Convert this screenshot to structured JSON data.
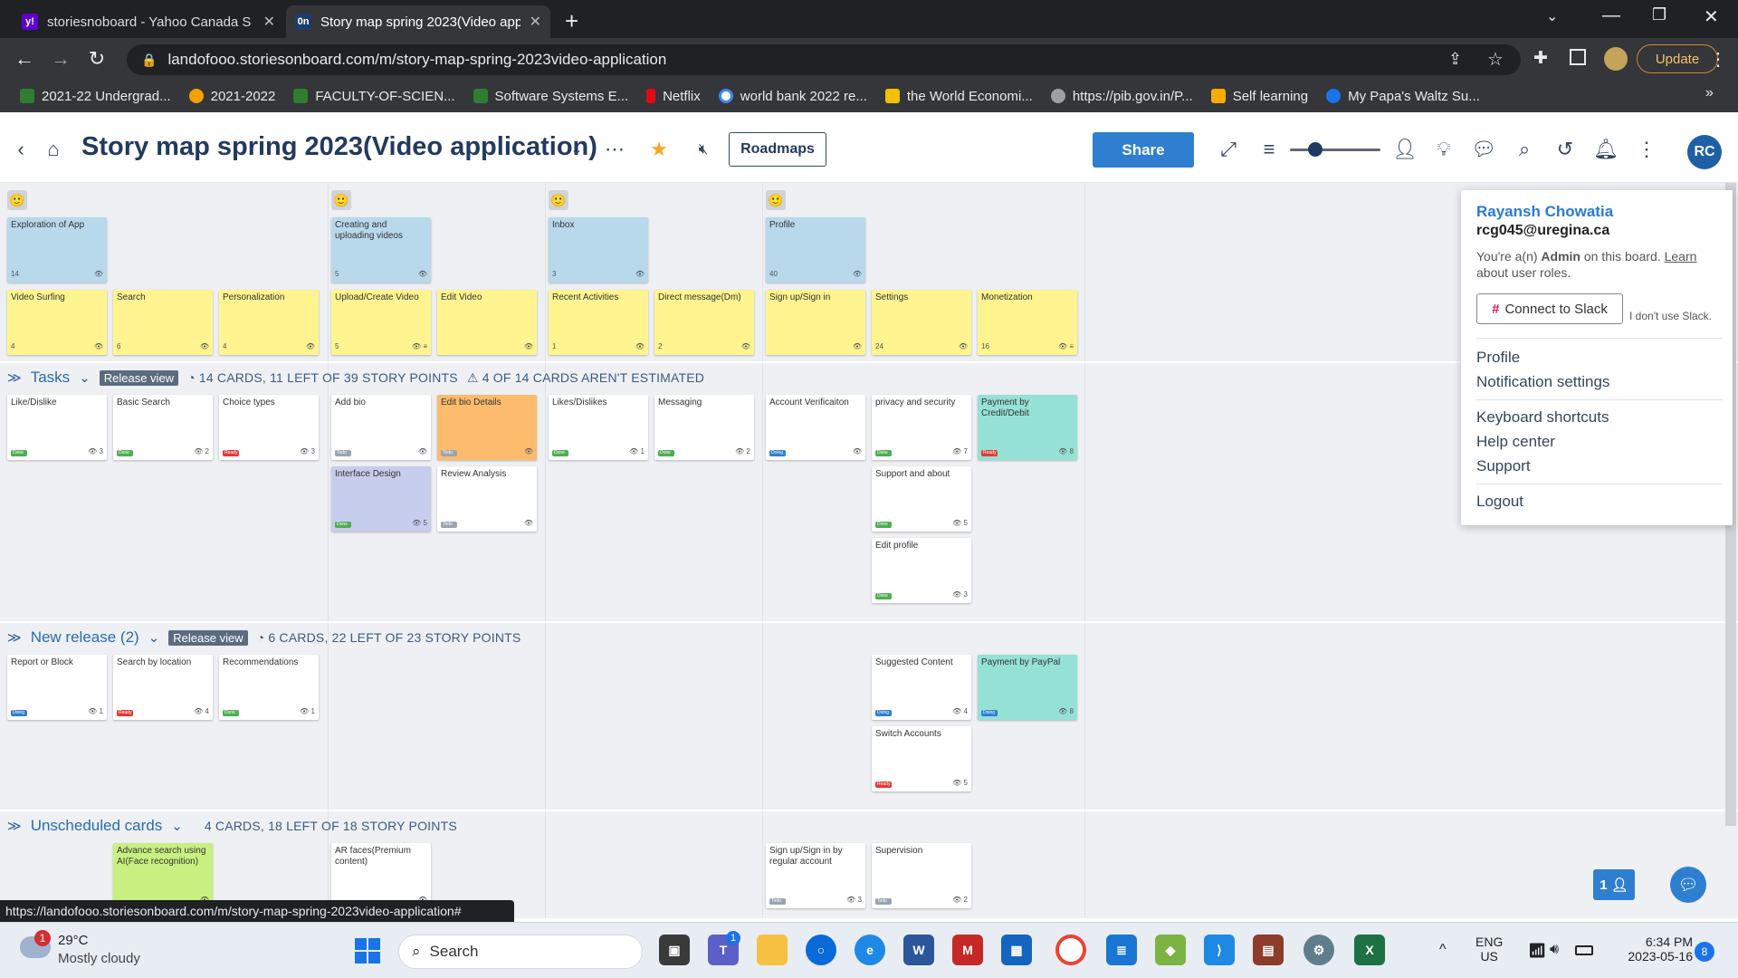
{
  "browser": {
    "tabs": [
      {
        "title": "storiesnoboard - Yahoo Canada S",
        "fav_letter": "y!",
        "fav_color": "#6001d2"
      },
      {
        "title": "Story map spring 2023(Video app",
        "fav_letter": "0n",
        "fav_color": "#1f3b6e"
      }
    ],
    "url": "landofooo.storiesonboard.com/m/story-map-spring-2023video-application",
    "update_label": "Update",
    "bookmarks": [
      {
        "label": "2021-22 Undergrad...",
        "color": "#2e7d32"
      },
      {
        "label": "2021-2022",
        "color": "#f4a000"
      },
      {
        "label": "FACULTY-OF-SCIEN...",
        "color": "#2e7d32"
      },
      {
        "label": "Software Systems E...",
        "color": "#2e7d32"
      },
      {
        "label": "Netflix",
        "color": "#e50914"
      },
      {
        "label": "world bank 2022 re...",
        "color": "#4285f4"
      },
      {
        "label": "the World Economi...",
        "color": "#f2c200"
      },
      {
        "label": "https://pib.gov.in/P...",
        "color": "#9aa0a6"
      },
      {
        "label": "Self learning",
        "color": "#f9ab00"
      },
      {
        "label": "My Papa's Waltz Su...",
        "color": "#1a73e8"
      }
    ]
  },
  "header": {
    "board_title": "Story map spring 2023(Video application)",
    "roadmaps_label": "Roadmaps",
    "share_label": "Share",
    "avatar_initials": "RC"
  },
  "goals": [
    {
      "label": "Exploration of App",
      "count": "14"
    },
    {
      "label": "Creating and uploading videos",
      "count": "5"
    },
    {
      "label": "Inbox",
      "count": "3"
    },
    {
      "label": "Profile",
      "count": "40"
    }
  ],
  "steps": [
    {
      "label": "Video Surfing",
      "count": "4"
    },
    {
      "label": "Search",
      "count": "6"
    },
    {
      "label": "Personalization",
      "count": "4"
    },
    {
      "label": "Upload/Create Video",
      "count": "5"
    },
    {
      "label": "Edit Video",
      "count": ""
    },
    {
      "label": "Recent Activities",
      "count": "1"
    },
    {
      "label": "Direct message(Dm)",
      "count": "2"
    },
    {
      "label": "Sign up/Sign in",
      "count": ""
    },
    {
      "label": "Settings",
      "count": "24"
    },
    {
      "label": "Monetization",
      "count": "16"
    }
  ],
  "releases": [
    {
      "name": "Tasks",
      "view": "Release view",
      "stats": "14 CARDS, 11 LEFT OF 39 STORY POINTS",
      "warn": "4 OF 14 CARDS AREN'T ESTIMATED"
    },
    {
      "name": "New release (2)",
      "view": "Release view",
      "stats": "6 CARDS, 22 LEFT OF 23 STORY POINTS",
      "warn": ""
    },
    {
      "name": "Unscheduled cards",
      "view": "",
      "stats": "4 CARDS, 18 LEFT OF 18 STORY POINTS",
      "warn": ""
    }
  ],
  "task_cards": [
    {
      "label": "Like/Dislike",
      "status": "Done",
      "points": "3"
    },
    {
      "label": "Basic Search",
      "status": "Done",
      "points": "2"
    },
    {
      "label": "Choice types",
      "status": "Ready",
      "points": "3"
    },
    {
      "label": "Add bio",
      "status": "Todo",
      "points": ""
    },
    {
      "label": "Edit bio Details",
      "status": "Todo",
      "points": ""
    },
    {
      "label": "Likes/Dislikes",
      "status": "Done",
      "points": "1"
    },
    {
      "label": "Messaging",
      "status": "Done",
      "points": "2"
    },
    {
      "label": "Account Verificaiton",
      "status": "Doing",
      "points": ""
    },
    {
      "label": "privacy and security",
      "status": "Done",
      "points": "7"
    },
    {
      "label": "Payment by Credit/Debit",
      "status": "Ready",
      "points": "8"
    },
    {
      "label": "Interface Design",
      "status": "Done",
      "points": "5"
    },
    {
      "label": "Review Analysis",
      "status": "Todo",
      "points": ""
    },
    {
      "label": "Support and about",
      "status": "Done",
      "points": "5"
    },
    {
      "label": "Edit profile",
      "status": "Done",
      "points": "3"
    }
  ],
  "release2_cards": [
    {
      "label": "Report or Block",
      "status": "Doing",
      "points": "1"
    },
    {
      "label": "Search by location",
      "status": "Ready",
      "points": "4"
    },
    {
      "label": "Recommendations",
      "status": "Done",
      "points": "1"
    },
    {
      "label": "Suggested Content",
      "status": "Doing",
      "points": "4"
    },
    {
      "label": "Payment by PayPal",
      "status": "Doing",
      "points": "8"
    },
    {
      "label": "Switch Accounts",
      "status": "Ready",
      "points": "5"
    }
  ],
  "unscheduled_cards": [
    {
      "label": "Advance search using AI(Face recognition)",
      "status": "",
      "points": ""
    },
    {
      "label": "AR faces(Premium content)",
      "status": "",
      "points": ""
    },
    {
      "label": "Sign up/Sign in by regular account",
      "status": "Todo",
      "points": "3"
    },
    {
      "label": "Supervision",
      "status": "Todo",
      "points": "2"
    }
  ],
  "user_menu": {
    "name": "Rayansh Chowatia",
    "email": "rcg045@uregina.ca",
    "role_prefix": "You're a(n) ",
    "role": "Admin",
    "role_mid": " on this board. ",
    "learn": "Learn",
    "role_suffix": "about user roles.",
    "slack_label": "Connect to Slack",
    "no_slack": "I don't use Slack.",
    "items": [
      "Profile",
      "Notification settings",
      "Keyboard shortcuts",
      "Help center",
      "Support",
      "Logout"
    ]
  },
  "status_url": "https://landofooo.storiesonboard.com/m/story-map-spring-2023video-application#",
  "taskbar": {
    "weather_temp": "29°C",
    "weather_desc": "Mostly cloudy",
    "weather_badge": "1",
    "search_label": "Search",
    "lang": "ENG",
    "region": "US",
    "time": "6:34 PM",
    "date": "2023-05-16",
    "notif_count": "8",
    "teams_badge": "1"
  },
  "colors": {
    "done": "#4caf50",
    "ready": "#e53935",
    "todo": "#9aa4b1",
    "doing": "#2f7fd0"
  }
}
